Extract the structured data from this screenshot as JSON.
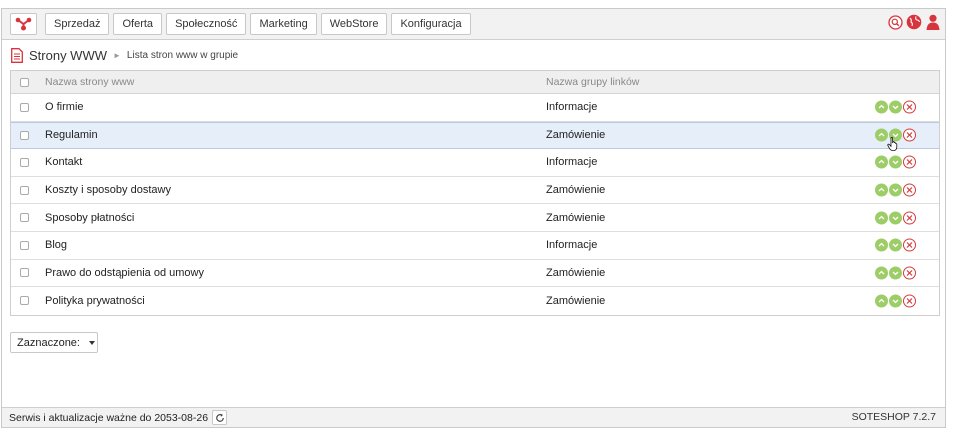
{
  "nav": {
    "logo_icon": "soteshop-logo-icon",
    "items": [
      {
        "label": "Sprzedaż"
      },
      {
        "label": "Oferta"
      },
      {
        "label": "Społeczność"
      },
      {
        "label": "Marketing"
      },
      {
        "label": "WebStore"
      },
      {
        "label": "Konfiguracja"
      }
    ],
    "right_icons": [
      "search-icon",
      "globe-icon",
      "user-icon"
    ]
  },
  "breadcrumb": {
    "title": "Strony WWW",
    "separator": "►",
    "current": "Lista stron www w grupie"
  },
  "table": {
    "headers": {
      "name": "Nazwa strony www",
      "group": "Nazwa grupy linków"
    },
    "rows": [
      {
        "name": "O firmie",
        "group": "Informacje"
      },
      {
        "name": "Regulamin",
        "group": "Zamówienie"
      },
      {
        "name": "Kontakt",
        "group": "Informacje"
      },
      {
        "name": "Koszty i sposoby dostawy",
        "group": "Zamówienie"
      },
      {
        "name": "Sposoby płatności",
        "group": "Zamówienie"
      },
      {
        "name": "Blog",
        "group": "Informacje"
      },
      {
        "name": "Prawo do odstąpienia od umowy",
        "group": "Zamówienie"
      },
      {
        "name": "Polityka prywatności",
        "group": "Zamówienie"
      }
    ],
    "row_actions": [
      "move-up-icon",
      "move-down-icon",
      "delete-icon"
    ]
  },
  "bulk_select": {
    "label": "Zaznaczone:"
  },
  "footer": {
    "status": "Serwis i aktualizacje ważne do 2053-08-26",
    "version": "SOTESHOP 7.2.7"
  },
  "colors": {
    "accent_red": "#d43b3b",
    "action_green": "#9ccd67",
    "row_highlight": "#e6eef9"
  }
}
